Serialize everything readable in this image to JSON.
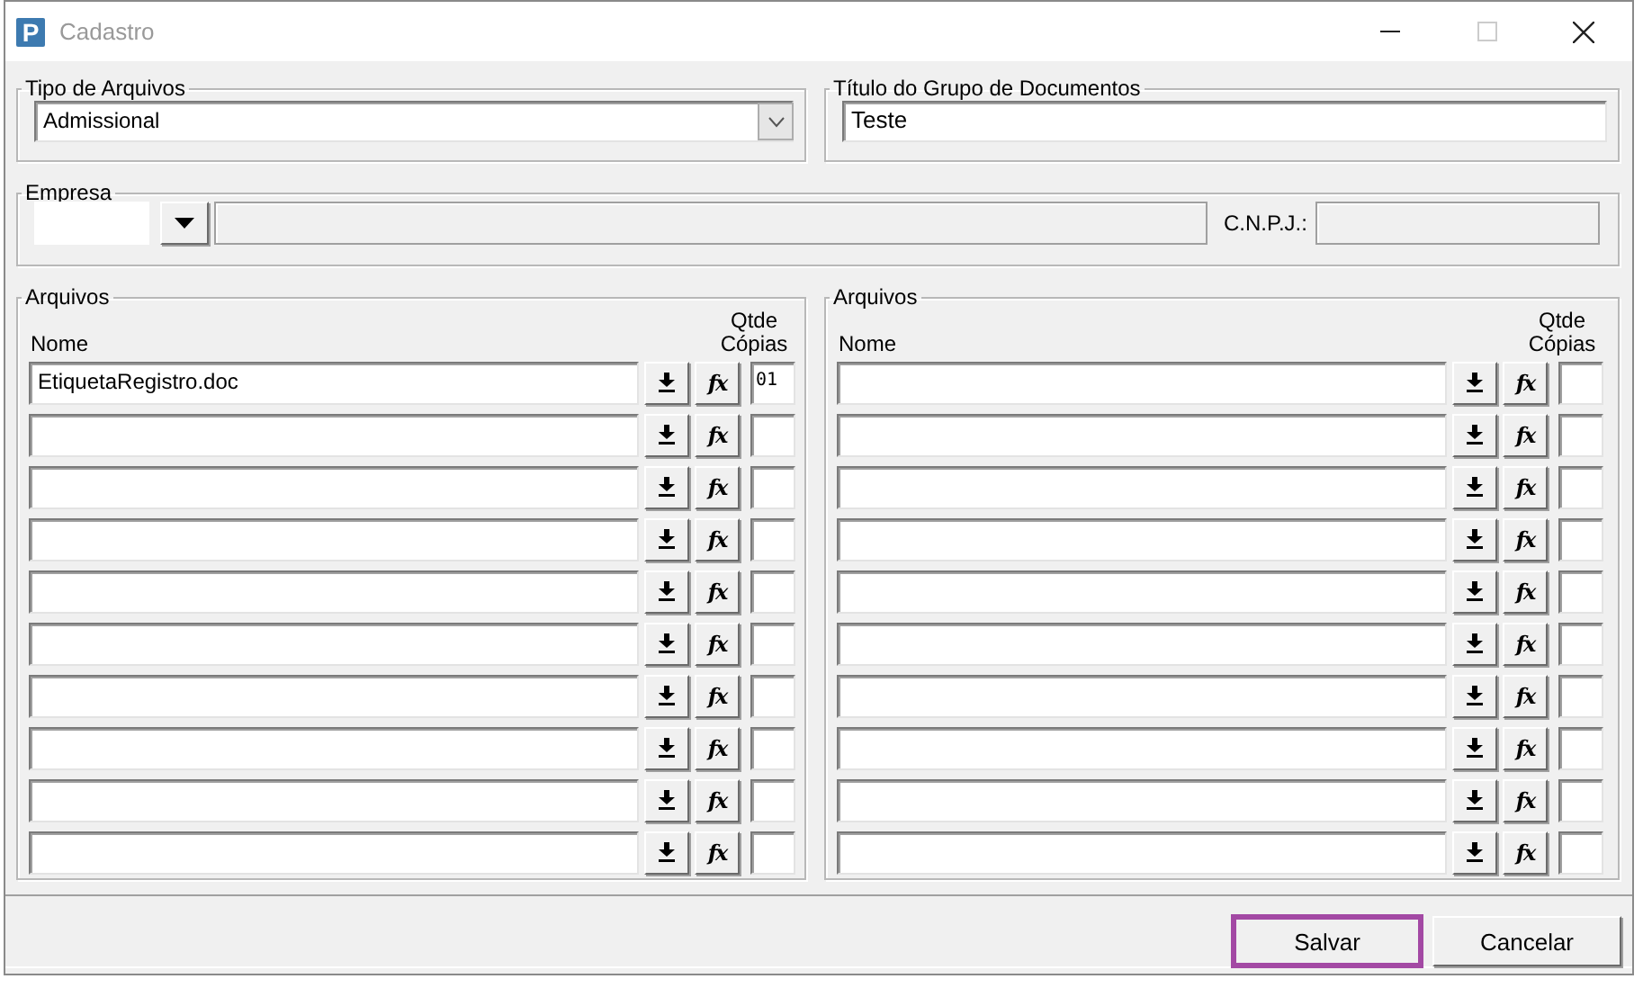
{
  "window": {
    "app_icon": "P",
    "title": "Cadastro",
    "maximize_disabled": true
  },
  "file_type": {
    "label": "Tipo de Arquivos",
    "value": "Admissional"
  },
  "group_title": {
    "label": "Título do Grupo de Documentos",
    "value": "Teste"
  },
  "company": {
    "label": "Empresa",
    "code_field": {
      "disabled": false
    },
    "name_field": {
      "disabled": true
    },
    "cnpj_label": "C.N.P.J.:",
    "cnpj_field": {
      "disabled": true
    }
  },
  "file_panels": [
    {
      "label": "Arquivos",
      "name_header": "Nome",
      "copies_header": "Qtde Cópias",
      "rows": [
        {
          "name": "EtiquetaRegistro.doc",
          "formula": "fx",
          "copies": "01"
        },
        {
          "formula": "fx"
        },
        {
          "formula": "fx"
        },
        {
          "formula": "fx"
        },
        {
          "formula": "fx"
        },
        {
          "formula": "fx"
        },
        {
          "formula": "fx"
        },
        {
          "formula": "fx"
        },
        {
          "formula": "fx"
        },
        {
          "formula": "fx"
        }
      ]
    },
    {
      "label": "Arquivos",
      "name_header": "Nome",
      "copies_header": "Qtde Cópias",
      "rows": [
        {
          "formula": "fx"
        },
        {
          "formula": "fx"
        },
        {
          "formula": "fx"
        },
        {
          "formula": "fx"
        },
        {
          "formula": "fx"
        },
        {
          "formula": "fx"
        },
        {
          "formula": "fx"
        },
        {
          "formula": "fx"
        },
        {
          "formula": "fx"
        },
        {
          "formula": "fx"
        }
      ]
    }
  ],
  "buttons": [
    {
      "label": "Salvar",
      "focused": true
    },
    {
      "label": "Cancelar",
      "focused": false
    }
  ]
}
